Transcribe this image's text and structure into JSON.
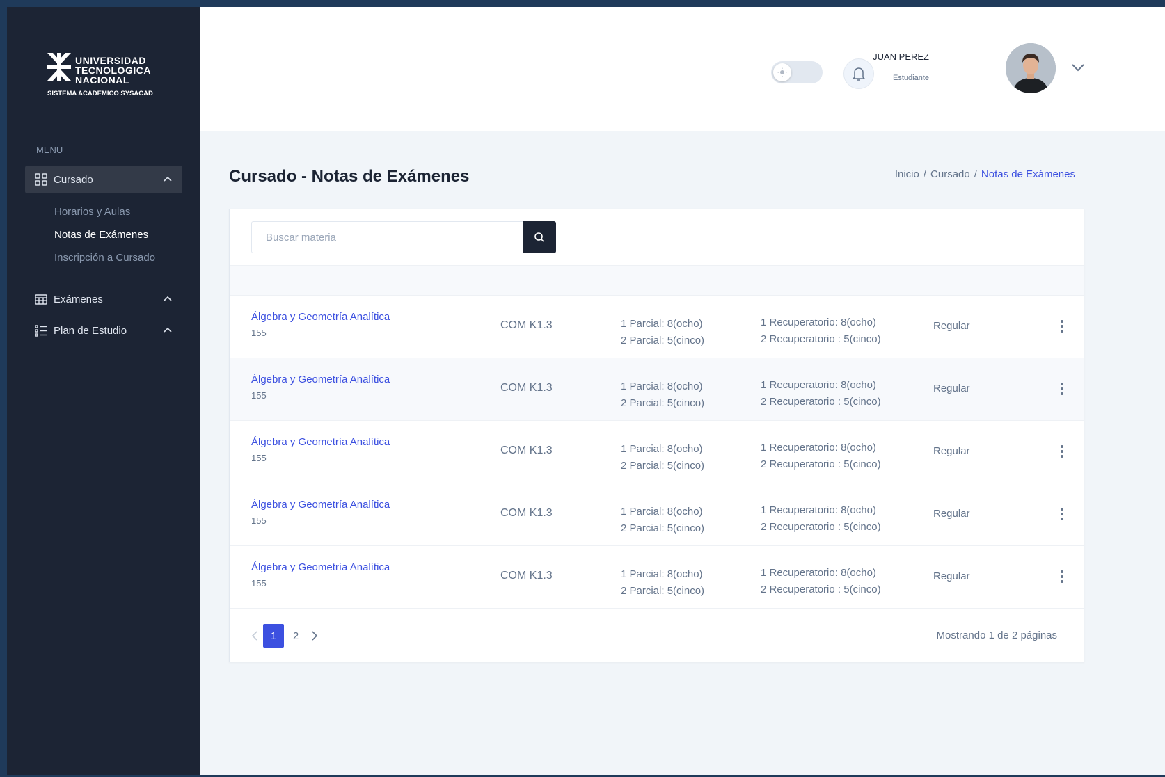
{
  "brand": {
    "line1": "UNIVERSIDAD",
    "line2": "TECNOLOGICA",
    "line3": "NACIONAL",
    "subtitle": "SISTEMA ACADEMICO SYSACAD"
  },
  "sidebar": {
    "menu_label": "MENU",
    "items": [
      {
        "label": "Cursado",
        "icon": "grid-icon",
        "expanded": true
      },
      {
        "label": "Exámenes",
        "icon": "calendar-icon",
        "expanded": false
      },
      {
        "label": "Plan de Estudio",
        "icon": "list-icon",
        "expanded": false
      }
    ],
    "subitems": [
      {
        "label": "Horarios y Aulas"
      },
      {
        "label": "Notas de Exámenes",
        "active": true
      },
      {
        "label": "Inscripción a Cursado"
      }
    ]
  },
  "header": {
    "user_name": "JUAN PEREZ",
    "user_role": "Estudiante"
  },
  "page": {
    "title": "Cursado - Notas de Exámenes",
    "breadcrumb": {
      "home": "Inicio",
      "section": "Cursado",
      "current": "Notas de Exámenes",
      "separator": "/"
    }
  },
  "search": {
    "placeholder": "Buscar materia"
  },
  "rows": [
    {
      "name": "Álgebra y Geometría Analítica",
      "code": "155",
      "commission": "COM K1.3",
      "parcial1": "1 Parcial: 8(ocho)",
      "parcial2": "2 Parcial: 5(cinco)",
      "recup1": "1 Recuperatorio: 8(ocho)",
      "recup2": "2 Recuperatorio : 5(cinco)",
      "status": "Regular"
    },
    {
      "name": "Álgebra y Geometría Analítica",
      "code": "155",
      "commission": "COM K1.3",
      "parcial1": "1 Parcial: 8(ocho)",
      "parcial2": "2 Parcial: 5(cinco)",
      "recup1": "1 Recuperatorio: 8(ocho)",
      "recup2": "2 Recuperatorio : 5(cinco)",
      "status": "Regular"
    },
    {
      "name": "Álgebra y Geometría Analítica",
      "code": "155",
      "commission": "COM K1.3",
      "parcial1": "1 Parcial: 8(ocho)",
      "parcial2": "2 Parcial: 5(cinco)",
      "recup1": "1 Recuperatorio: 8(ocho)",
      "recup2": "2 Recuperatorio : 5(cinco)",
      "status": "Regular"
    },
    {
      "name": "Álgebra y Geometría Analítica",
      "code": "155",
      "commission": "COM K1.3",
      "parcial1": "1 Parcial: 8(ocho)",
      "parcial2": "2 Parcial: 5(cinco)",
      "recup1": "1 Recuperatorio: 8(ocho)",
      "recup2": "2 Recuperatorio : 5(cinco)",
      "status": "Regular"
    },
    {
      "name": "Álgebra y Geometría Analítica",
      "code": "155",
      "commission": "COM K1.3",
      "parcial1": "1 Parcial: 8(ocho)",
      "parcial2": "2 Parcial: 5(cinco)",
      "recup1": "1 Recuperatorio: 8(ocho)",
      "recup2": "2 Recuperatorio : 5(cinco)",
      "status": "Regular"
    }
  ],
  "pagination": {
    "pages": [
      "1",
      "2"
    ],
    "current": "1",
    "info": "Mostrando 1 de 2 páginas"
  },
  "colors": {
    "sidebar_bg": "#1c2434",
    "accent": "#3c50e0",
    "page_bg": "#f1f5f9"
  }
}
